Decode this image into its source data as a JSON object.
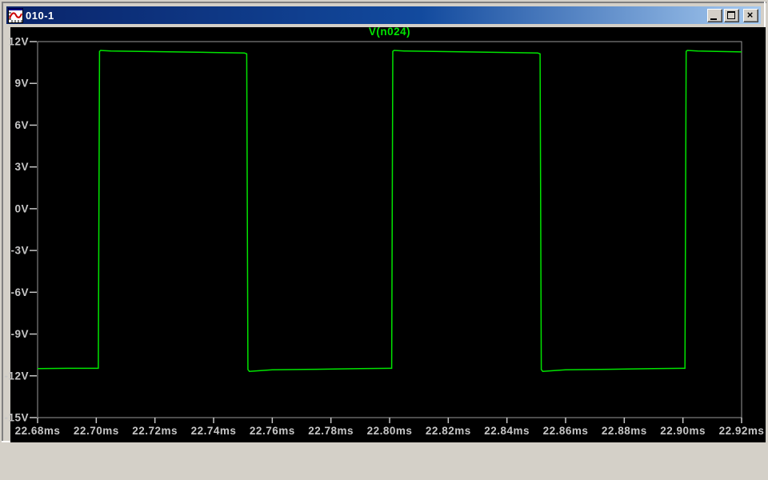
{
  "window": {
    "title": "010-1",
    "icon": "waveform-chart-icon",
    "controls": {
      "minimize_icon": "underscore-bar",
      "maximize_icon": "square-outline",
      "close_icon": "x-cross",
      "close_glyph": "×"
    }
  },
  "colors": {
    "titlebar_gradient_left": "#0a246a",
    "titlebar_gradient_right": "#a6caf0",
    "frame_gray": "#d4d0c8",
    "plot_background": "#000000",
    "axis_line": "#9a9a9a",
    "axis_label": "#c6c6c6",
    "trace_green": "#00e400",
    "title_green": "#00e400"
  },
  "chart_data": {
    "type": "line",
    "title": "V(n024)",
    "xlabel": "",
    "ylabel": "",
    "x_unit": "ms",
    "y_unit": "V",
    "xlim": [
      22.68,
      22.92
    ],
    "ylim": [
      -15,
      12
    ],
    "grid": false,
    "legend_position": "top-center-title",
    "x_ticks": [
      "22.68ms",
      "22.70ms",
      "22.72ms",
      "22.74ms",
      "22.76ms",
      "22.78ms",
      "22.80ms",
      "22.82ms",
      "22.84ms",
      "22.86ms",
      "22.88ms",
      "22.90ms",
      "22.92ms"
    ],
    "y_ticks": [
      "12V",
      "9V",
      "6V",
      "3V",
      "0V",
      "-3V",
      "-6V",
      "-9V",
      "-12V",
      "-15V"
    ],
    "series": [
      {
        "name": "V(n024)",
        "color": "#00e400",
        "waveform": "square",
        "high_level_v": 11.3,
        "low_level_v": -11.5,
        "period_ms": 0.1,
        "rising_edges_ms": [
          22.7007,
          22.8007,
          22.9007
        ],
        "falling_edges_ms": [
          22.7517,
          22.8517
        ],
        "points": [
          [
            22.68,
            -11.48
          ],
          [
            22.69,
            -11.46
          ],
          [
            22.7,
            -11.46
          ],
          [
            22.7007,
            -11.46
          ],
          [
            22.7011,
            11.3
          ],
          [
            22.7015,
            11.37
          ],
          [
            22.705,
            11.33
          ],
          [
            22.715,
            11.3
          ],
          [
            22.74,
            11.22
          ],
          [
            22.7505,
            11.18
          ],
          [
            22.7513,
            11.12
          ],
          [
            22.7517,
            -11.55
          ],
          [
            22.7522,
            -11.68
          ],
          [
            22.756,
            -11.62
          ],
          [
            22.76,
            -11.57
          ],
          [
            22.775,
            -11.53
          ],
          [
            22.79,
            -11.48
          ],
          [
            22.8,
            -11.46
          ],
          [
            22.8007,
            -11.46
          ],
          [
            22.8011,
            11.3
          ],
          [
            22.8015,
            11.37
          ],
          [
            22.805,
            11.33
          ],
          [
            22.815,
            11.3
          ],
          [
            22.84,
            11.22
          ],
          [
            22.8505,
            11.18
          ],
          [
            22.8513,
            11.12
          ],
          [
            22.8517,
            -11.55
          ],
          [
            22.8522,
            -11.68
          ],
          [
            22.856,
            -11.62
          ],
          [
            22.86,
            -11.57
          ],
          [
            22.875,
            -11.53
          ],
          [
            22.89,
            -11.48
          ],
          [
            22.8997,
            -11.46
          ],
          [
            22.9007,
            -11.46
          ],
          [
            22.9011,
            11.3
          ],
          [
            22.9015,
            11.37
          ],
          [
            22.905,
            11.33
          ],
          [
            22.915,
            11.28
          ],
          [
            22.92,
            11.26
          ]
        ]
      }
    ]
  }
}
